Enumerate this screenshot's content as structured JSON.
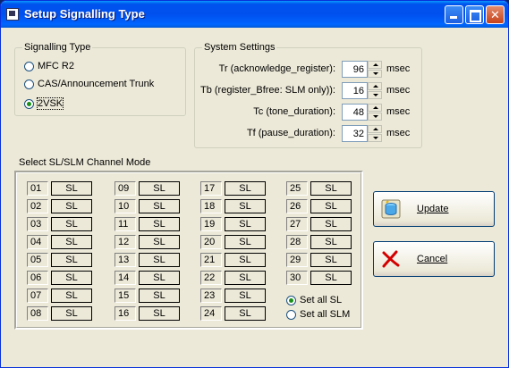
{
  "window": {
    "title": "Setup Signalling Type"
  },
  "signalling": {
    "legend": "Signalling Type",
    "options": [
      "MFC R2",
      "CAS/Announcement Trunk",
      "2VSK"
    ],
    "selected": "2VSK"
  },
  "system": {
    "legend": "System Settings",
    "rows": [
      {
        "label": "Tr (acknowledge_register):",
        "value": "96",
        "unit": "msec"
      },
      {
        "label": "Tb (register_Bfree: SLM only)):",
        "value": "16",
        "unit": "msec"
      },
      {
        "label": "Tc (tone_duration):",
        "value": "48",
        "unit": "msec"
      },
      {
        "label": "Tf (pause_duration):",
        "value": "32",
        "unit": "msec"
      }
    ]
  },
  "channels": {
    "legend": "Select SL/SLM Channel Mode",
    "items": [
      {
        "num": "01",
        "mode": "SL"
      },
      {
        "num": "02",
        "mode": "SL"
      },
      {
        "num": "03",
        "mode": "SL"
      },
      {
        "num": "04",
        "mode": "SL"
      },
      {
        "num": "05",
        "mode": "SL"
      },
      {
        "num": "06",
        "mode": "SL"
      },
      {
        "num": "07",
        "mode": "SL"
      },
      {
        "num": "08",
        "mode": "SL"
      },
      {
        "num": "09",
        "mode": "SL"
      },
      {
        "num": "10",
        "mode": "SL"
      },
      {
        "num": "11",
        "mode": "SL"
      },
      {
        "num": "12",
        "mode": "SL"
      },
      {
        "num": "13",
        "mode": "SL"
      },
      {
        "num": "14",
        "mode": "SL"
      },
      {
        "num": "15",
        "mode": "SL"
      },
      {
        "num": "16",
        "mode": "SL"
      },
      {
        "num": "17",
        "mode": "SL"
      },
      {
        "num": "18",
        "mode": "SL"
      },
      {
        "num": "19",
        "mode": "SL"
      },
      {
        "num": "20",
        "mode": "SL"
      },
      {
        "num": "21",
        "mode": "SL"
      },
      {
        "num": "22",
        "mode": "SL"
      },
      {
        "num": "23",
        "mode": "SL"
      },
      {
        "num": "24",
        "mode": "SL"
      },
      {
        "num": "25",
        "mode": "SL"
      },
      {
        "num": "26",
        "mode": "SL"
      },
      {
        "num": "27",
        "mode": "SL"
      },
      {
        "num": "28",
        "mode": "SL"
      },
      {
        "num": "29",
        "mode": "SL"
      },
      {
        "num": "30",
        "mode": "SL"
      }
    ],
    "set_all_sl": "Set all SL",
    "set_all_slm": "Set all SLM",
    "set_all_selected": "Set all SL"
  },
  "buttons": {
    "update": "Update",
    "cancel": "Cancel"
  },
  "icons": {
    "update": "database-icon",
    "cancel": "cancel-x-icon",
    "app": "window-app-icon"
  },
  "colors": {
    "titlebar": "#0054e3",
    "face": "#ece9d8",
    "radio_dot": "#1a8f1a",
    "cancel_icon": "#d40000"
  }
}
